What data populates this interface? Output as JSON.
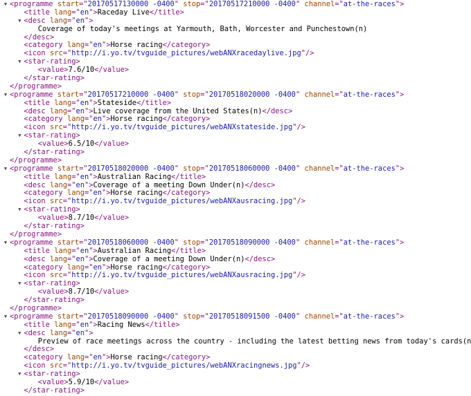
{
  "toggle_glyph": "▼",
  "lines": [
    {
      "indent": 0,
      "toggle": true,
      "tokens": [
        [
          "tag",
          "<programme "
        ],
        [
          "an",
          "start"
        ],
        [
          "tag",
          "=\""
        ],
        [
          "av",
          "20170517130000 -0400"
        ],
        [
          "tag",
          "\" "
        ],
        [
          "an",
          "stop"
        ],
        [
          "tag",
          "=\""
        ],
        [
          "av",
          "20170517210000 -0400"
        ],
        [
          "tag",
          "\" "
        ],
        [
          "an",
          "channel"
        ],
        [
          "tag",
          "=\""
        ],
        [
          "av",
          "at-the-races"
        ],
        [
          "tag",
          "\">"
        ]
      ]
    },
    {
      "indent": 1,
      "tokens": [
        [
          "tag",
          "<title "
        ],
        [
          "an",
          "lang"
        ],
        [
          "tag",
          "=\""
        ],
        [
          "av",
          "en"
        ],
        [
          "tag",
          "\">"
        ],
        [
          "tx",
          "Raceday Live"
        ],
        [
          "tag",
          "</title>"
        ]
      ]
    },
    {
      "indent": 1,
      "toggle": true,
      "tokens": [
        [
          "tag",
          "<desc "
        ],
        [
          "an",
          "lang"
        ],
        [
          "tag",
          "=\""
        ],
        [
          "av",
          "en"
        ],
        [
          "tag",
          "\">"
        ]
      ]
    },
    {
      "indent": 2,
      "tokens": [
        [
          "tx",
          "Coverage of today's meetings at Yarmouth, Bath, Worcester and Punchestown(n)"
        ]
      ]
    },
    {
      "indent": 1,
      "tokens": [
        [
          "tag",
          "</desc>"
        ]
      ]
    },
    {
      "indent": 1,
      "tokens": [
        [
          "tag",
          "<category "
        ],
        [
          "an",
          "lang"
        ],
        [
          "tag",
          "=\""
        ],
        [
          "av",
          "en"
        ],
        [
          "tag",
          "\">"
        ],
        [
          "tx",
          "Horse racing"
        ],
        [
          "tag",
          "</category>"
        ]
      ]
    },
    {
      "indent": 1,
      "tokens": [
        [
          "tag",
          "<icon "
        ],
        [
          "an",
          "src"
        ],
        [
          "tag",
          "=\""
        ],
        [
          "av",
          "http://i.yo.tv/tvguide_pictures/webANXracedaylive.jpg"
        ],
        [
          "tag",
          "\"/>"
        ]
      ]
    },
    {
      "indent": 1,
      "toggle": true,
      "tokens": [
        [
          "tag",
          "<star-rating>"
        ]
      ]
    },
    {
      "indent": 2,
      "tokens": [
        [
          "tag",
          "<value>"
        ],
        [
          "tx",
          "7.6/10"
        ],
        [
          "tag",
          "</value>"
        ]
      ]
    },
    {
      "indent": 1,
      "tokens": [
        [
          "tag",
          "</star-rating>"
        ]
      ]
    },
    {
      "indent": 0,
      "tokens": [
        [
          "tag",
          "</programme>"
        ]
      ]
    },
    {
      "indent": 0,
      "toggle": true,
      "tokens": [
        [
          "tag",
          "<programme "
        ],
        [
          "an",
          "start"
        ],
        [
          "tag",
          "=\""
        ],
        [
          "av",
          "20170517210000 -0400"
        ],
        [
          "tag",
          "\" "
        ],
        [
          "an",
          "stop"
        ],
        [
          "tag",
          "=\""
        ],
        [
          "av",
          "20170518020000 -0400"
        ],
        [
          "tag",
          "\" "
        ],
        [
          "an",
          "channel"
        ],
        [
          "tag",
          "=\""
        ],
        [
          "av",
          "at-the-races"
        ],
        [
          "tag",
          "\">"
        ]
      ]
    },
    {
      "indent": 1,
      "tokens": [
        [
          "tag",
          "<title "
        ],
        [
          "an",
          "lang"
        ],
        [
          "tag",
          "=\""
        ],
        [
          "av",
          "en"
        ],
        [
          "tag",
          "\">"
        ],
        [
          "tx",
          "Stateside"
        ],
        [
          "tag",
          "</title>"
        ]
      ]
    },
    {
      "indent": 1,
      "tokens": [
        [
          "tag",
          "<desc "
        ],
        [
          "an",
          "lang"
        ],
        [
          "tag",
          "=\""
        ],
        [
          "av",
          "en"
        ],
        [
          "tag",
          "\">"
        ],
        [
          "tx",
          "Live coverage from the United States(n)"
        ],
        [
          "tag",
          "</desc>"
        ]
      ]
    },
    {
      "indent": 1,
      "tokens": [
        [
          "tag",
          "<category "
        ],
        [
          "an",
          "lang"
        ],
        [
          "tag",
          "=\""
        ],
        [
          "av",
          "en"
        ],
        [
          "tag",
          "\">"
        ],
        [
          "tx",
          "Horse racing"
        ],
        [
          "tag",
          "</category>"
        ]
      ]
    },
    {
      "indent": 1,
      "tokens": [
        [
          "tag",
          "<icon "
        ],
        [
          "an",
          "src"
        ],
        [
          "tag",
          "=\""
        ],
        [
          "av",
          "http://i.yo.tv/tvguide_pictures/webANXstateside.jpg"
        ],
        [
          "tag",
          "\"/>"
        ]
      ]
    },
    {
      "indent": 1,
      "toggle": true,
      "tokens": [
        [
          "tag",
          "<star-rating>"
        ]
      ]
    },
    {
      "indent": 2,
      "tokens": [
        [
          "tag",
          "<value>"
        ],
        [
          "tx",
          "6.5/10"
        ],
        [
          "tag",
          "</value>"
        ]
      ]
    },
    {
      "indent": 1,
      "tokens": [
        [
          "tag",
          "</star-rating>"
        ]
      ]
    },
    {
      "indent": 0,
      "tokens": [
        [
          "tag",
          "</programme>"
        ]
      ]
    },
    {
      "indent": 0,
      "toggle": true,
      "tokens": [
        [
          "tag",
          "<programme "
        ],
        [
          "an",
          "start"
        ],
        [
          "tag",
          "=\""
        ],
        [
          "av",
          "20170518020000 -0400"
        ],
        [
          "tag",
          "\" "
        ],
        [
          "an",
          "stop"
        ],
        [
          "tag",
          "=\""
        ],
        [
          "av",
          "20170518060000 -0400"
        ],
        [
          "tag",
          "\" "
        ],
        [
          "an",
          "channel"
        ],
        [
          "tag",
          "=\""
        ],
        [
          "av",
          "at-the-races"
        ],
        [
          "tag",
          "\">"
        ]
      ]
    },
    {
      "indent": 1,
      "tokens": [
        [
          "tag",
          "<title "
        ],
        [
          "an",
          "lang"
        ],
        [
          "tag",
          "=\""
        ],
        [
          "av",
          "en"
        ],
        [
          "tag",
          "\">"
        ],
        [
          "tx",
          "Australian Racing"
        ],
        [
          "tag",
          "</title>"
        ]
      ]
    },
    {
      "indent": 1,
      "tokens": [
        [
          "tag",
          "<desc "
        ],
        [
          "an",
          "lang"
        ],
        [
          "tag",
          "=\""
        ],
        [
          "av",
          "en"
        ],
        [
          "tag",
          "\">"
        ],
        [
          "tx",
          "Coverage of a meeting Down Under(n)"
        ],
        [
          "tag",
          "</desc>"
        ]
      ]
    },
    {
      "indent": 1,
      "tokens": [
        [
          "tag",
          "<category "
        ],
        [
          "an",
          "lang"
        ],
        [
          "tag",
          "=\""
        ],
        [
          "av",
          "en"
        ],
        [
          "tag",
          "\">"
        ],
        [
          "tx",
          "Horse racing"
        ],
        [
          "tag",
          "</category>"
        ]
      ]
    },
    {
      "indent": 1,
      "tokens": [
        [
          "tag",
          "<icon "
        ],
        [
          "an",
          "src"
        ],
        [
          "tag",
          "=\""
        ],
        [
          "av",
          "http://i.yo.tv/tvguide_pictures/webANXausracing.jpg"
        ],
        [
          "tag",
          "\"/>"
        ]
      ]
    },
    {
      "indent": 1,
      "toggle": true,
      "tokens": [
        [
          "tag",
          "<star-rating>"
        ]
      ]
    },
    {
      "indent": 2,
      "tokens": [
        [
          "tag",
          "<value>"
        ],
        [
          "tx",
          "8.7/10"
        ],
        [
          "tag",
          "</value>"
        ]
      ]
    },
    {
      "indent": 1,
      "tokens": [
        [
          "tag",
          "</star-rating>"
        ]
      ]
    },
    {
      "indent": 0,
      "tokens": [
        [
          "tag",
          "</programme>"
        ]
      ]
    },
    {
      "indent": 0,
      "toggle": true,
      "tokens": [
        [
          "tag",
          "<programme "
        ],
        [
          "an",
          "start"
        ],
        [
          "tag",
          "=\""
        ],
        [
          "av",
          "20170518060000 -0400"
        ],
        [
          "tag",
          "\" "
        ],
        [
          "an",
          "stop"
        ],
        [
          "tag",
          "=\""
        ],
        [
          "av",
          "20170518090000 -0400"
        ],
        [
          "tag",
          "\" "
        ],
        [
          "an",
          "channel"
        ],
        [
          "tag",
          "=\""
        ],
        [
          "av",
          "at-the-races"
        ],
        [
          "tag",
          "\">"
        ]
      ]
    },
    {
      "indent": 1,
      "tokens": [
        [
          "tag",
          "<title "
        ],
        [
          "an",
          "lang"
        ],
        [
          "tag",
          "=\""
        ],
        [
          "av",
          "en"
        ],
        [
          "tag",
          "\">"
        ],
        [
          "tx",
          "Australian Racing"
        ],
        [
          "tag",
          "</title>"
        ]
      ]
    },
    {
      "indent": 1,
      "tokens": [
        [
          "tag",
          "<desc "
        ],
        [
          "an",
          "lang"
        ],
        [
          "tag",
          "=\""
        ],
        [
          "av",
          "en"
        ],
        [
          "tag",
          "\">"
        ],
        [
          "tx",
          "Coverage of a meeting Down Under(n)"
        ],
        [
          "tag",
          "</desc>"
        ]
      ]
    },
    {
      "indent": 1,
      "tokens": [
        [
          "tag",
          "<category "
        ],
        [
          "an",
          "lang"
        ],
        [
          "tag",
          "=\""
        ],
        [
          "av",
          "en"
        ],
        [
          "tag",
          "\">"
        ],
        [
          "tx",
          "Horse racing"
        ],
        [
          "tag",
          "</category>"
        ]
      ]
    },
    {
      "indent": 1,
      "tokens": [
        [
          "tag",
          "<icon "
        ],
        [
          "an",
          "src"
        ],
        [
          "tag",
          "=\""
        ],
        [
          "av",
          "http://i.yo.tv/tvguide_pictures/webANXausracing.jpg"
        ],
        [
          "tag",
          "\"/>"
        ]
      ]
    },
    {
      "indent": 1,
      "toggle": true,
      "tokens": [
        [
          "tag",
          "<star-rating>"
        ]
      ]
    },
    {
      "indent": 2,
      "tokens": [
        [
          "tag",
          "<value>"
        ],
        [
          "tx",
          "8.7/10"
        ],
        [
          "tag",
          "</value>"
        ]
      ]
    },
    {
      "indent": 1,
      "tokens": [
        [
          "tag",
          "</star-rating>"
        ]
      ]
    },
    {
      "indent": 0,
      "tokens": [
        [
          "tag",
          "</programme>"
        ]
      ]
    },
    {
      "indent": 0,
      "toggle": true,
      "tokens": [
        [
          "tag",
          "<programme "
        ],
        [
          "an",
          "start"
        ],
        [
          "tag",
          "=\""
        ],
        [
          "av",
          "20170518090000 -0400"
        ],
        [
          "tag",
          "\" "
        ],
        [
          "an",
          "stop"
        ],
        [
          "tag",
          "=\""
        ],
        [
          "av",
          "20170518091500 -0400"
        ],
        [
          "tag",
          "\" "
        ],
        [
          "an",
          "channel"
        ],
        [
          "tag",
          "=\""
        ],
        [
          "av",
          "at-the-races"
        ],
        [
          "tag",
          "\">"
        ]
      ]
    },
    {
      "indent": 1,
      "tokens": [
        [
          "tag",
          "<title "
        ],
        [
          "an",
          "lang"
        ],
        [
          "tag",
          "=\""
        ],
        [
          "av",
          "en"
        ],
        [
          "tag",
          "\">"
        ],
        [
          "tx",
          "Racing News"
        ],
        [
          "tag",
          "</title>"
        ]
      ]
    },
    {
      "indent": 1,
      "toggle": true,
      "tokens": [
        [
          "tag",
          "<desc "
        ],
        [
          "an",
          "lang"
        ],
        [
          "tag",
          "=\""
        ],
        [
          "av",
          "en"
        ],
        [
          "tag",
          "\">"
        ]
      ]
    },
    {
      "indent": 2,
      "tokens": [
        [
          "tx",
          "Preview of race meetings across the country - including the latest betting news from today's cards(n)"
        ]
      ]
    },
    {
      "indent": 1,
      "tokens": [
        [
          "tag",
          "</desc>"
        ]
      ]
    },
    {
      "indent": 1,
      "tokens": [
        [
          "tag",
          "<category "
        ],
        [
          "an",
          "lang"
        ],
        [
          "tag",
          "=\""
        ],
        [
          "av",
          "en"
        ],
        [
          "tag",
          "\">"
        ],
        [
          "tx",
          "Horse racing"
        ],
        [
          "tag",
          "</category>"
        ]
      ]
    },
    {
      "indent": 1,
      "tokens": [
        [
          "tag",
          "<icon "
        ],
        [
          "an",
          "src"
        ],
        [
          "tag",
          "=\""
        ],
        [
          "av",
          "http://i.yo.tv/tvguide_pictures/webANXracingnews.jpg"
        ],
        [
          "tag",
          "\"/>"
        ]
      ]
    },
    {
      "indent": 1,
      "toggle": true,
      "tokens": [
        [
          "tag",
          "<star-rating>"
        ]
      ]
    },
    {
      "indent": 2,
      "tokens": [
        [
          "tag",
          "<value>"
        ],
        [
          "tx",
          "5.9/10"
        ],
        [
          "tag",
          "</value>"
        ]
      ]
    },
    {
      "indent": 1,
      "tokens": [
        [
          "tag",
          "</star-rating>"
        ]
      ]
    }
  ]
}
